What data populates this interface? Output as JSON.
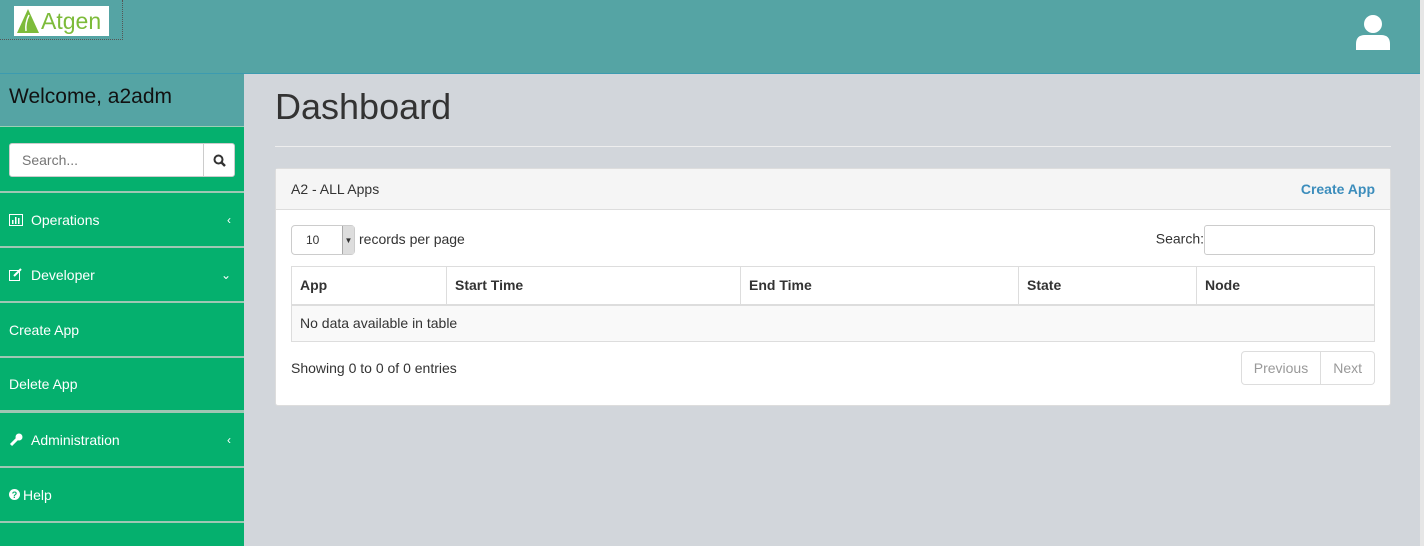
{
  "header": {
    "logo_text": "Atgen",
    "user_icon": "user-icon"
  },
  "sidebar": {
    "welcome": "Welcome, a2adm",
    "search_placeholder": "Search...",
    "items": [
      {
        "label": "Operations",
        "icon": "bar-chart-icon"
      },
      {
        "label": "Developer",
        "icon": "edit-icon"
      },
      {
        "label": "Create App"
      },
      {
        "label": "Delete App"
      },
      {
        "label": "Administration",
        "icon": "wrench-icon"
      },
      {
        "label": "Help",
        "icon": "question-circle-icon"
      }
    ]
  },
  "main": {
    "title": "Dashboard",
    "panel": {
      "title": "A2 - ALL Apps",
      "create_link": "Create App",
      "page_size": "10",
      "records_label": "records per page",
      "search_label": "Search:",
      "columns": [
        "App",
        "Start Time",
        "End Time",
        "State",
        "Node"
      ],
      "empty": "No data available in table",
      "info": "Showing 0 to 0 of 0 entries",
      "prev": "Previous",
      "next": "Next"
    }
  }
}
